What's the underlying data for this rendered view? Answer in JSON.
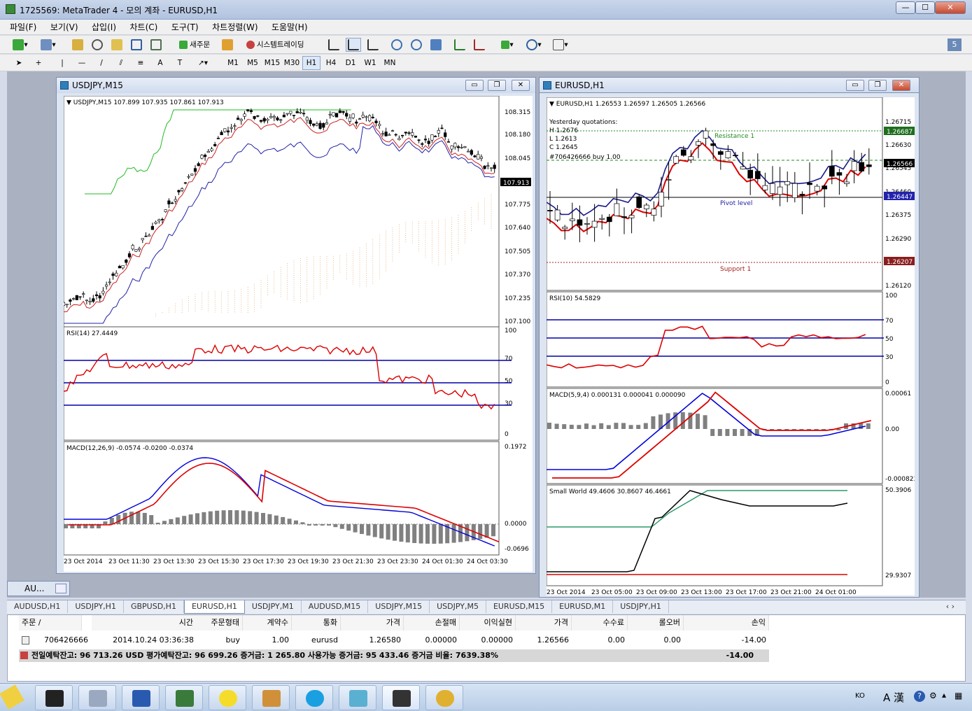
{
  "window": {
    "title": "1725569: MetaTrader 4 - 모의 계좌 - EURUSD,H1"
  },
  "menu": [
    "파일(F)",
    "보기(V)",
    "삽입(I)",
    "차트(C)",
    "도구(T)",
    "차트정렬(W)",
    "도움말(H)"
  ],
  "toolbar": {
    "new_order": "새주문",
    "system_trading": "시스템트레이딩",
    "periods": [
      "M1",
      "M5",
      "M15",
      "M30",
      "H1",
      "H4",
      "D1",
      "W1",
      "MN"
    ],
    "active_period": "H1",
    "search_badge": "5"
  },
  "chart_usdjpy": {
    "window_title": "USDJPY,M15",
    "price_label": "USDJPY,M15  107.899 107.935 107.861 107.913",
    "price_axis": [
      "108.315",
      "108.180",
      "108.045",
      "107.913",
      "107.775",
      "107.640",
      "107.505",
      "107.370",
      "107.235",
      "107.100"
    ],
    "current_price": "107.913",
    "rsi_label": "RSI(14) 27.4449",
    "rsi_axis": [
      "100",
      "70",
      "50",
      "30",
      "0"
    ],
    "macd_label": "MACD(12,26,9) -0.0574 -0.0200 -0.0374",
    "macd_axis": [
      "0.1972",
      "0.0000",
      "-0.0696"
    ],
    "time_axis": [
      "23 Oct 2014",
      "23 Oct 11:30",
      "23 Oct 13:30",
      "23 Oct 15:30",
      "23 Oct 17:30",
      "23 Oct 19:30",
      "23 Oct 21:30",
      "23 Oct 23:30",
      "24 Oct 01:30",
      "24 Oct 03:30"
    ]
  },
  "chart_eurusd": {
    "window_title": "EURUSD,H1",
    "price_label": "EURUSD,H1  1.26553 1.26597 1.26505 1.26566",
    "yesterday": [
      "Yesterday quotations:",
      "H 1.2676",
      "L 1.2613",
      "C 1.2645"
    ],
    "order_label": "#706426666 buy 1.00",
    "resistance_label": "Resistance 1",
    "pivot_label": "Pivot level",
    "support_label": "Support 1",
    "price_axis": [
      "1.26715",
      "1.26630",
      "1.26545",
      "1.26460",
      "1.26375",
      "1.26290",
      "1.26120"
    ],
    "resistance_price": "1.26687",
    "current_price": "1.26566",
    "pivot_price": "1.26447",
    "support_price": "1.26207",
    "rsi_label": "RSI(10) 54.5829",
    "rsi_axis": [
      "100",
      "70",
      "50",
      "30",
      "0"
    ],
    "macd_label": "MACD(5,9,4) 0.000131 0.000041 0.000090",
    "macd_axis": [
      "0.00061",
      "0.00",
      "-0.000823"
    ],
    "sw_label": "Small World 49.4606 30.8607 46.4661",
    "sw_axis": [
      "50.3906",
      "29.9307"
    ],
    "time_axis": [
      "23 Oct 2014",
      "23 Oct 05:00",
      "23 Oct 09:00",
      "23 Oct 13:00",
      "23 Oct 17:00",
      "23 Oct 21:00",
      "24 Oct 01:00"
    ]
  },
  "minimized": "AU...",
  "symbol_tabs": [
    "AUDUSD,H1",
    "USDJPY,H1",
    "GBPUSD,H1",
    "EURUSD,H1",
    "USDJPY,M1",
    "AUDUSD,M15",
    "USDJPY,M15",
    "USDJPY,M5",
    "EURUSD,M15",
    "EURUSD,M1",
    "USDJPY,H1"
  ],
  "active_tab": "EURUSD,H1",
  "terminal": {
    "headers": [
      "주문",
      "시간",
      "주문형태",
      "계약수",
      "통화",
      "가격",
      "손절매",
      "이익실현",
      "가격",
      "수수료",
      "롤오버",
      "손익"
    ],
    "order": [
      "706426666",
      "2014.10.24 03:36:38",
      "buy",
      "1.00",
      "eurusd",
      "1.26580",
      "0.00000",
      "0.00000",
      "1.26566",
      "0.00",
      "0.00",
      "-14.00"
    ],
    "balance": "전일예탁잔고: 96 713.26 USD  평가예탁잔고: 96 699.26  증거금: 1 265.80  사용가능 증거금: 95 433.46  증거금 비율: 7639.38%",
    "total": "-14.00"
  },
  "tray": {
    "lang": "KO",
    "ime": "A 漢"
  }
}
